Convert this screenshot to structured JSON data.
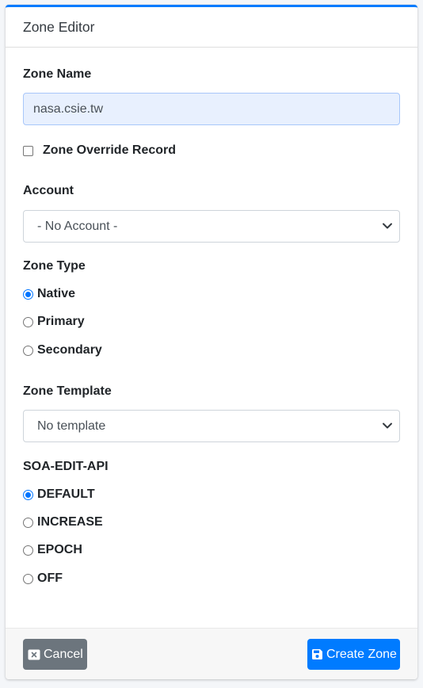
{
  "header": {
    "title": "Zone Editor"
  },
  "zone_name": {
    "label": "Zone Name",
    "value": "nasa.csie.tw"
  },
  "override": {
    "label": "Zone Override Record",
    "checked": false
  },
  "account": {
    "label": "Account",
    "selected": "- No Account -"
  },
  "zone_type": {
    "label": "Zone Type",
    "options": [
      {
        "label": "Native",
        "checked": true
      },
      {
        "label": "Primary",
        "checked": false
      },
      {
        "label": "Secondary",
        "checked": false
      }
    ]
  },
  "zone_template": {
    "label": "Zone Template",
    "selected": "No template"
  },
  "soa_edit_api": {
    "label": "SOA-EDIT-API",
    "options": [
      {
        "label": "DEFAULT",
        "checked": true
      },
      {
        "label": "INCREASE",
        "checked": false
      },
      {
        "label": "EPOCH",
        "checked": false
      },
      {
        "label": "OFF",
        "checked": false
      }
    ]
  },
  "footer": {
    "cancel_label": "Cancel",
    "create_label": "Create Zone"
  },
  "icons": {
    "cancel": "close-box-icon",
    "create": "floppy-disk-icon",
    "select": "chevron-down-icon"
  },
  "colors": {
    "accent": "#007bff",
    "secondary": "#6c757d",
    "autofill": "#e8f0fe"
  }
}
